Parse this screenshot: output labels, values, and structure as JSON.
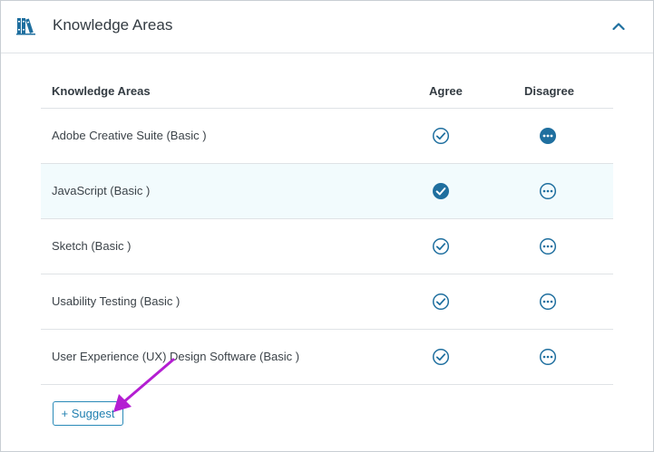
{
  "panel": {
    "title": "Knowledge Areas",
    "icon": "books-icon",
    "collapse_icon": "chevron-up-icon"
  },
  "table": {
    "headers": {
      "area": "Knowledge Areas",
      "agree": "Agree",
      "disagree": "Disagree"
    },
    "rows": [
      {
        "name": "Adobe Creative Suite (Basic )",
        "agree_selected": false,
        "disagree_selected": true,
        "highlighted": false
      },
      {
        "name": "JavaScript (Basic )",
        "agree_selected": true,
        "disagree_selected": false,
        "highlighted": true
      },
      {
        "name": "Sketch (Basic )",
        "agree_selected": false,
        "disagree_selected": false,
        "highlighted": false
      },
      {
        "name": "Usability Testing (Basic )",
        "agree_selected": false,
        "disagree_selected": false,
        "highlighted": false
      },
      {
        "name": "User Experience (UX) Design Software (Basic )",
        "agree_selected": false,
        "disagree_selected": false,
        "highlighted": false
      }
    ]
  },
  "suggest_button": {
    "label": "+ Suggest"
  },
  "colors": {
    "accent": "#1f6f9f",
    "row_highlight": "#f2fbfd",
    "annotation_arrow": "#b41ed2"
  }
}
